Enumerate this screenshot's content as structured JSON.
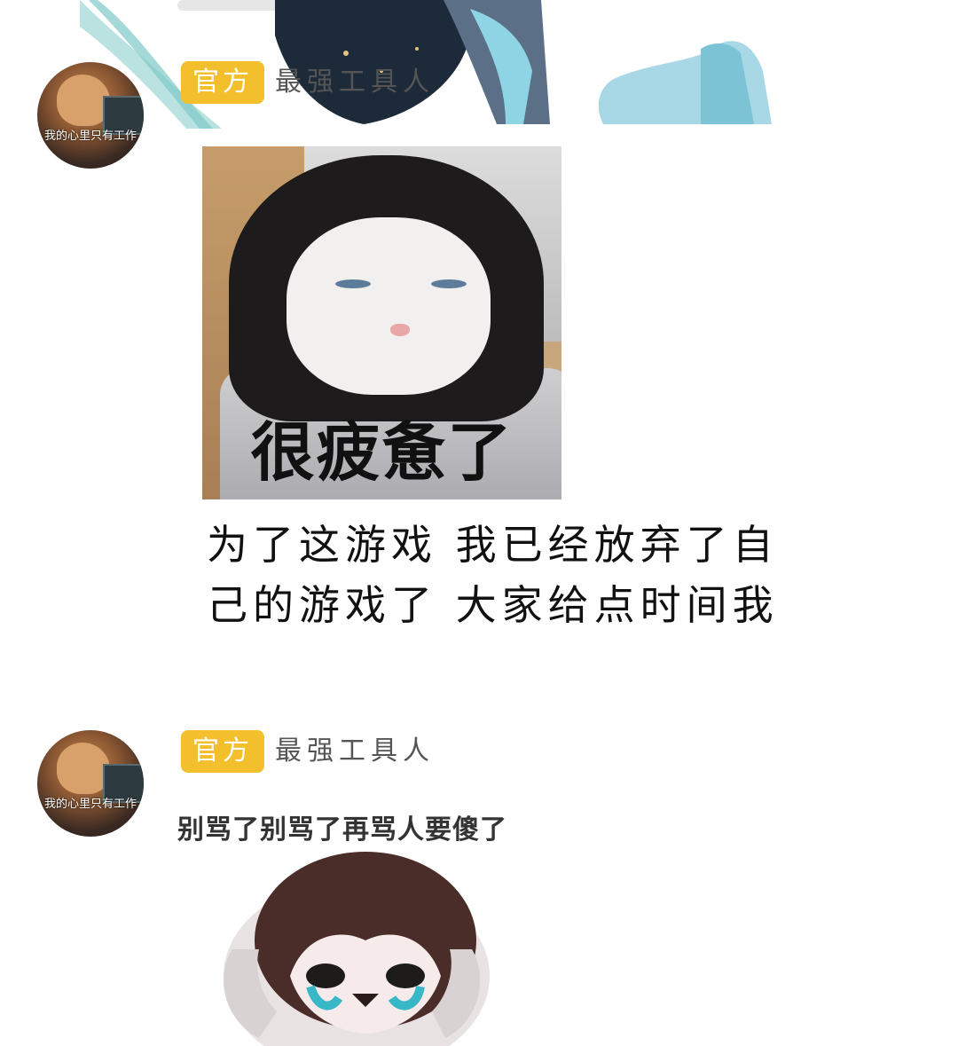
{
  "messages": [
    {
      "badge": "官方",
      "username": "最强工具人",
      "avatar_caption": "我的心里只有工作",
      "image_caption": "很疲惫了",
      "text": "为了这游戏 我已经放弃了自己的游戏了 大家给点时间我"
    },
    {
      "badge": "官方",
      "username": "最强工具人",
      "avatar_caption": "我的心里只有工作",
      "image_caption": "别骂了别骂了再骂人要傻了"
    }
  ],
  "colors": {
    "badge_bg": "#f3bf2c",
    "badge_text": "#ffffff",
    "username": "#555555",
    "message_text": "#111111"
  }
}
